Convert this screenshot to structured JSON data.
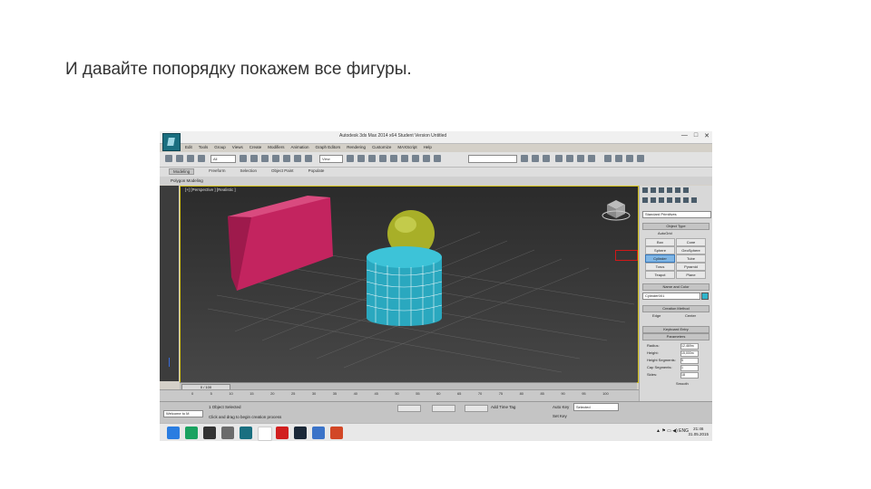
{
  "caption": "И давайте попорядку покажем все фигуры.",
  "window": {
    "title": "Autodesk 3ds Max  2014 x64   Student Version    Untitled",
    "controls": [
      "—",
      "□",
      "✕"
    ]
  },
  "menu": [
    "Edit",
    "Tools",
    "Group",
    "Views",
    "Create",
    "Modifiers",
    "Animation",
    "Graph Editors",
    "Rendering",
    "Customize",
    "MAXScript",
    "Help"
  ],
  "toolbar": {
    "selection_filter": "All",
    "coord_system": "View"
  },
  "ribbon": {
    "tabs": [
      "Modeling",
      "Freeform",
      "Selection",
      "Object Paint",
      "Populate"
    ],
    "subtitle": "Polygon Modeling"
  },
  "viewport": {
    "label": "[+] [Perspective ] [Realistic ]",
    "colors": {
      "box": "#c3245f",
      "sphere": "#aeb52d",
      "cylinder": "#2fb4cb",
      "border": "#d4c21a"
    }
  },
  "command_panel": {
    "category": "Standard Primitives",
    "object_type_header": "Object Type",
    "autogrid": "AutoGrid",
    "objects": [
      "Box",
      "Cone",
      "Sphere",
      "GeoSphere",
      "Cylinder",
      "Tube",
      "Torus",
      "Pyramid",
      "Teapot",
      "Plane"
    ],
    "active_object": "Cylinder",
    "name_color_header": "Name and Color",
    "object_name": "Cylinder001",
    "creation_method_header": "Creation Method",
    "creation_methods": [
      "Edge",
      "Center"
    ],
    "keyboard_entry_header": "Keyboard Entry",
    "parameters_header": "Parameters",
    "params": [
      {
        "label": "Radius:",
        "value": "12,469m"
      },
      {
        "label": "Height:",
        "value": "15,000m"
      },
      {
        "label": "Height Segments:",
        "value": "5"
      },
      {
        "label": "Cap Segments:",
        "value": "1"
      },
      {
        "label": "Sides:",
        "value": "18"
      }
    ],
    "smooth": "Smooth"
  },
  "timeline": {
    "frame_display": "0 / 100",
    "ticks": [
      "0",
      "5",
      "10",
      "15",
      "20",
      "25",
      "30",
      "35",
      "40",
      "45",
      "50",
      "55",
      "60",
      "65",
      "70",
      "75",
      "80",
      "85",
      "90",
      "95",
      "100"
    ]
  },
  "status": {
    "maxscript": "Welcome to M",
    "line1": "1 Object Selected",
    "line2": "Click and drag to begin creation process",
    "add_time_tag": "Add Time Tag",
    "auto_key": "Auto Key",
    "selected": "Selected",
    "set_key": "Set Key"
  },
  "taskbar": {
    "tray": "▲ ⚑ ▭ ◀) ENG",
    "time": "21:46",
    "date": "31.05.2015"
  }
}
